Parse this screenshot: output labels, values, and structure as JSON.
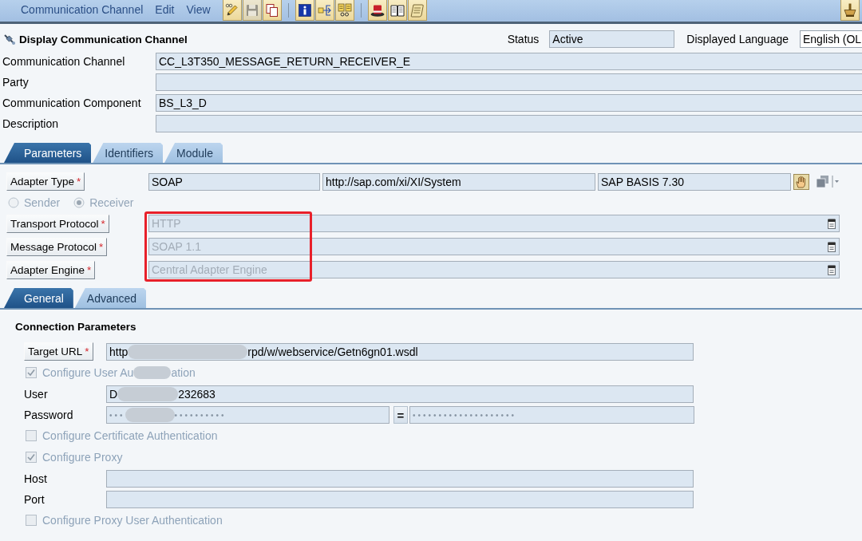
{
  "menu": [
    {
      "label": "Communication Channel"
    },
    {
      "label": "Edit"
    },
    {
      "label": "View"
    }
  ],
  "toolbar": [
    [
      {
        "kind": "edit",
        "disabled": false
      },
      {
        "kind": "save",
        "disabled": true
      },
      {
        "kind": "copy",
        "disabled": false
      }
    ],
    [
      {
        "kind": "info",
        "disabled": false
      },
      {
        "kind": "route",
        "disabled": false
      },
      {
        "kind": "compare",
        "disabled": false
      }
    ],
    [
      {
        "kind": "hat",
        "disabled": false
      },
      {
        "kind": "book",
        "disabled": false
      },
      {
        "kind": "scroll",
        "disabled": false
      }
    ]
  ],
  "toolbar_end": [
    {
      "kind": "mortar",
      "disabled": false
    }
  ],
  "header": {
    "title": "Display Communication Channel",
    "status": {
      "label": "Status",
      "value": "Active"
    },
    "language": {
      "label": "Displayed Language",
      "value": "English (OL"
    }
  },
  "object_fields": [
    {
      "label": "Communication Channel",
      "value": "CC_L3T350_MESSAGE_RETURN_RECEIVER_E"
    },
    {
      "label": "Party"
    },
    {
      "label": "Communication Component",
      "value": "BS_L3_D"
    },
    {
      "label": "Description"
    }
  ],
  "tabs": [
    {
      "label": "Parameters",
      "selected": true
    },
    {
      "label": "Identifiers",
      "selected": false
    },
    {
      "label": "Module",
      "selected": false
    }
  ],
  "adapter_type": {
    "label": "Adapter Type",
    "required_mark": "*",
    "values": [
      "SOAP",
      "http://sap.com/xi/XI/System",
      "SAP BASIS 7.30"
    ]
  },
  "direction": [
    {
      "label": "Sender",
      "selected": false,
      "disabled": true
    },
    {
      "label": "Receiver",
      "selected": true,
      "disabled": true
    }
  ],
  "protocols": {
    "highlighted": true,
    "rows": [
      {
        "label": "Transport Protocol",
        "required_mark": "*",
        "value": "HTTP",
        "disabled": true
      },
      {
        "label": "Message Protocol",
        "required_mark": "*",
        "value": "SOAP 1.1",
        "disabled": true
      },
      {
        "label": "Adapter Engine",
        "required_mark": "*",
        "value": "Central Adapter Engine",
        "disabled": true
      }
    ]
  },
  "subtabs": [
    {
      "label": "General",
      "selected": true
    },
    {
      "label": "Advanced",
      "selected": false
    }
  ],
  "connection": {
    "title": "Connection Parameters",
    "rows": [
      {
        "kind": "action",
        "label": "Target URL",
        "required_mark": "*",
        "value_parts": [
          "http",
          "rpd/w/webservice/Getn6gn01.wsdl"
        ]
      },
      {
        "kind": "checkbox",
        "label_parts": [
          "Configure User Au",
          "ation"
        ],
        "checked": true,
        "disabled": true
      },
      {
        "kind": "field",
        "label": "User",
        "value_parts": [
          "D",
          "232683"
        ]
      },
      {
        "kind": "password",
        "label": "Password",
        "value_parts": [
          "•••",
          "••••••••••"
        ],
        "confirm_button": "=",
        "confirm_value": "••••••••••••••••••••"
      },
      {
        "kind": "checkbox",
        "label_parts": [
          "Configure Certificate Authentication"
        ],
        "checked": false,
        "disabled": true
      },
      {
        "kind": "checkbox",
        "label_parts": [
          "Configure Proxy"
        ],
        "checked": true,
        "disabled": true
      },
      {
        "kind": "field",
        "label": "Host"
      },
      {
        "kind": "field",
        "label": "Port"
      },
      {
        "kind": "checkbox",
        "label_parts": [
          "Configure Proxy User Authentication"
        ],
        "checked": false,
        "disabled": true
      }
    ]
  }
}
